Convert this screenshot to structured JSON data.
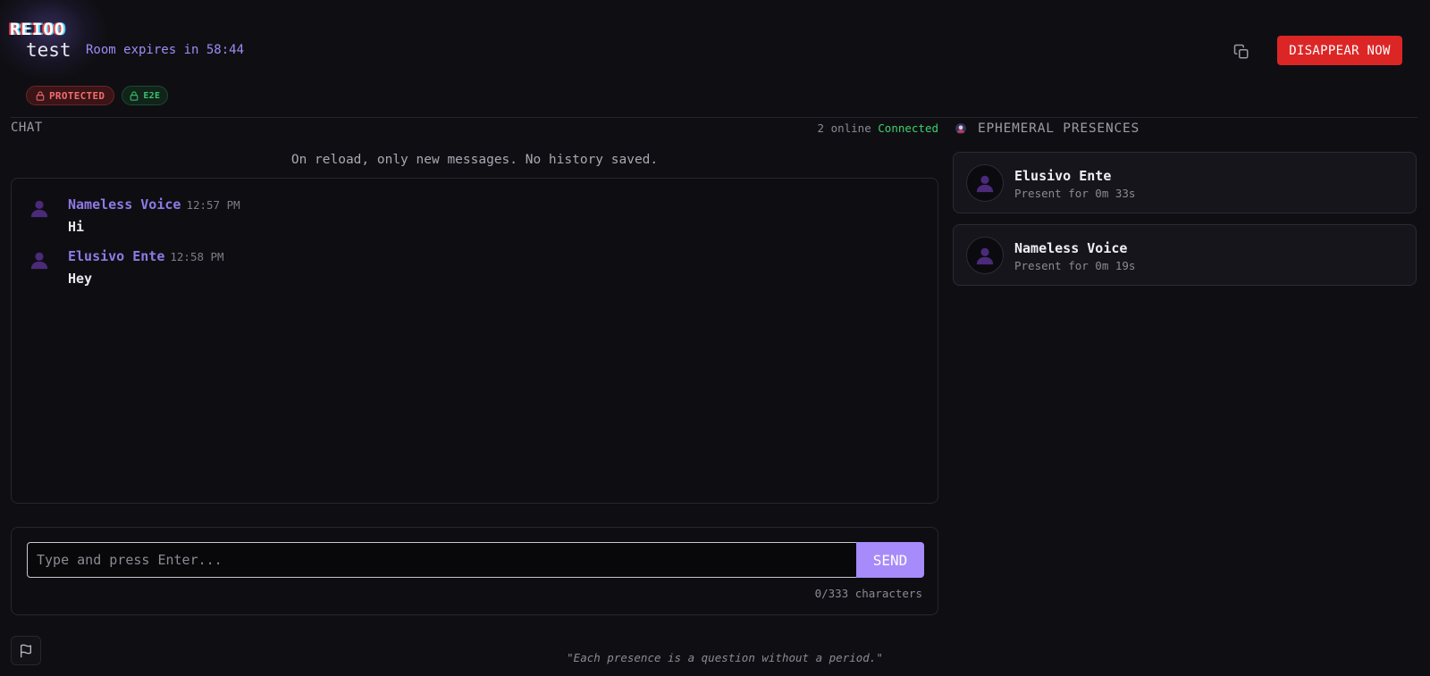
{
  "header": {
    "logo": "REIOO",
    "room_name": "test",
    "room_expiry": "Room expires in 58:44",
    "copy_icon": "copy-icon",
    "disappear_label": "DISAPPEAR NOW"
  },
  "badges": {
    "protected": "PROTECTED",
    "e2e": "E2E"
  },
  "chat": {
    "title": "CHAT",
    "online": "2 online",
    "status": "Connected",
    "notice": "On reload, only new messages. No history saved.",
    "messages": [
      {
        "author": "Nameless Voice",
        "time": "12:57 PM",
        "text": "Hi"
      },
      {
        "author": "Elusivo Ente",
        "time": "12:58 PM",
        "text": "Hey"
      }
    ],
    "input_placeholder": "Type and press Enter...",
    "input_value": "",
    "send_label": "SEND",
    "char_count": "0/333 characters"
  },
  "presences": {
    "title": "EPHEMERAL PRESENCES",
    "items": [
      {
        "name": "Elusivo Ente",
        "duration": "Present for 0m 33s"
      },
      {
        "name": "Nameless Voice",
        "duration": "Present for 0m 19s"
      }
    ]
  },
  "footer": {
    "quote": "\"Each presence is a question without a period.\"",
    "report_icon": "flag-icon"
  },
  "colors": {
    "background": "#0f0f13",
    "accent": "#a78bfa",
    "author": "#8f7ae6",
    "danger": "#dc2626",
    "connected": "#3ecf6e"
  }
}
